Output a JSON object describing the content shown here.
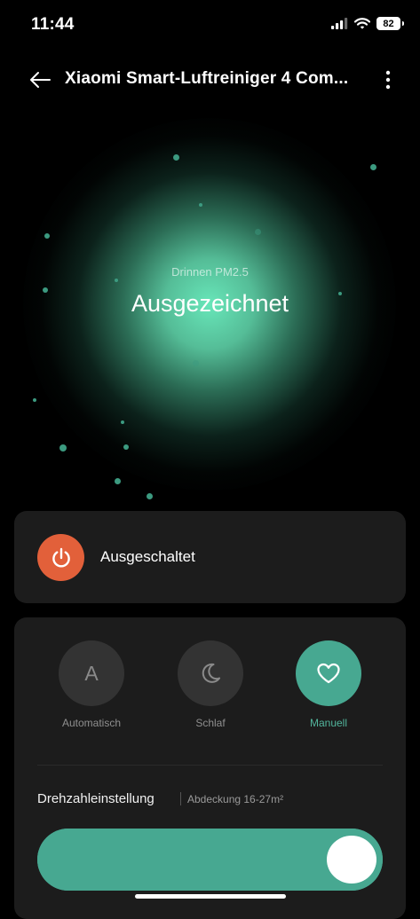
{
  "status_bar": {
    "time": "11:44",
    "battery": "82"
  },
  "header": {
    "title": "Xiaomi Smart-Luftreiniger 4 Com..."
  },
  "hero": {
    "pm_label": "Drinnen PM2.5",
    "air_quality": "Ausgezeichnet"
  },
  "power": {
    "status": "Ausgeschaltet",
    "color": "#e2603a"
  },
  "modes": [
    {
      "label": "Automatisch",
      "icon_letter": "A",
      "icon": "auto-letter-icon",
      "active": false
    },
    {
      "label": "Schlaf",
      "icon": "moon-icon",
      "active": false
    },
    {
      "label": "Manuell",
      "icon": "heart-icon",
      "active": true
    }
  ],
  "speed": {
    "title": "Drehzahleinstellung",
    "coverage": "Abdeckung 16-27m²",
    "level": 1.0
  },
  "colors": {
    "accent": "#47a891",
    "accent_text": "#52b59c",
    "background": "#000000",
    "card": "#1c1c1c"
  }
}
